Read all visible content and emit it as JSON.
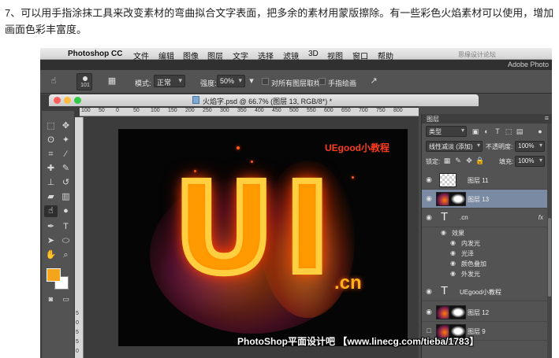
{
  "article": {
    "intro_text": "7、可以用手指涂抹工具来改变素材的弯曲拟合文字表面，把多余的素材用蒙版擦除。有一些彩色火焰素材可以使用，增加画面色彩丰富度。"
  },
  "menubar": {
    "app_name": "Photoshop CC",
    "menus": [
      "文件",
      "编辑",
      "图像",
      "图层",
      "文字",
      "选择",
      "滤镜",
      "3D",
      "视图",
      "窗口",
      "帮助"
    ],
    "site_watermark": "思缘设计论坛 www.MISSYUAN.COM"
  },
  "app_title": "Adobe Photo",
  "options_bar": {
    "brush_size": "101",
    "mode_label": "模式:",
    "mode_value": "正常",
    "strength_label": "强度:",
    "strength_value": "50%",
    "sample_all_layers_label": "对所有图层取样",
    "finger_painting_label": "手指绘画"
  },
  "document": {
    "title": "火焰字.psd @ 66.7% (图层 13, RGB/8*) *",
    "ruler_marks": [
      "100",
      "50",
      "0",
      "50",
      "100",
      "150",
      "200",
      "250",
      "300",
      "350",
      "400",
      "450",
      "500",
      "550",
      "600",
      "650",
      "700",
      "750",
      "800"
    ],
    "vruler_marks": [
      "5",
      "0",
      "5",
      "5",
      "0"
    ]
  },
  "canvas": {
    "big_text": "UI",
    "cn_text": ".cn",
    "label": "UEgood小教程"
  },
  "tools": {
    "foreground_color": "#f5a51c",
    "background_color": "#ffffff"
  },
  "layers_panel": {
    "title": "图层",
    "filter_type": "类型",
    "blend_mode": "线性减淡 (添加)",
    "opacity_label": "不透明度:",
    "opacity_value": "100%",
    "lock_label": "锁定:",
    "fill_label": "填充:",
    "fill_value": "100%",
    "layers": [
      {
        "name": "图层 11",
        "kind": "raster",
        "selected": false
      },
      {
        "name": "图层 13",
        "kind": "raster-mask",
        "selected": true
      },
      {
        "name": ".cn",
        "kind": "text",
        "fx": "fx"
      },
      {
        "name": "UEgood小教程",
        "kind": "text"
      },
      {
        "name": "图层 12",
        "kind": "raster-mask"
      },
      {
        "name": "图层 9",
        "kind": "raster-mask"
      }
    ],
    "effects_label": "效果",
    "effects": [
      "内发光",
      "光泽",
      "颜色叠加",
      "外发光"
    ]
  },
  "bottom_watermark": "PhotoShop平面设计吧 【www.linecg.com/tieba/1783】"
}
